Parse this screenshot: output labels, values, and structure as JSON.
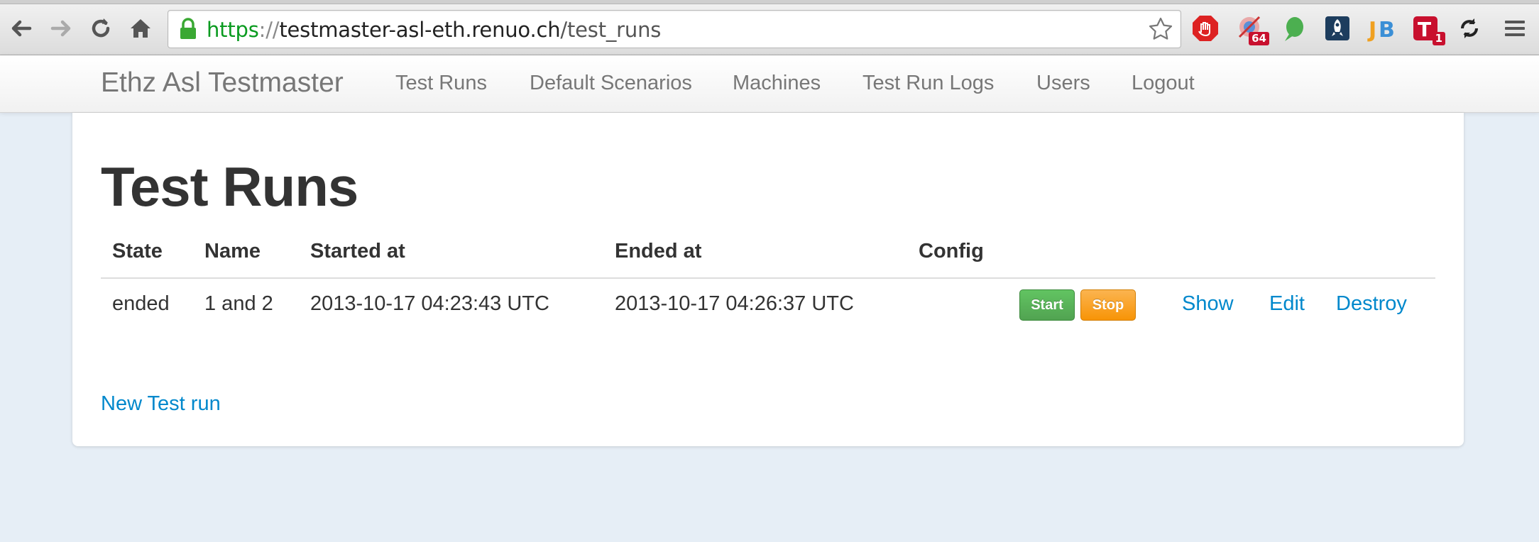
{
  "browser": {
    "url_scheme": "https",
    "url_separator": "://",
    "url_host": "testmaster-asl-eth.renuo.ch",
    "url_path": "/test_runs",
    "icons": [
      "back-icon",
      "forward-icon",
      "reload-icon",
      "home-icon",
      "lock-icon",
      "star-icon",
      "menu-icon"
    ],
    "extensions": [
      {
        "icon": "adblock-icon",
        "badge": ""
      },
      {
        "icon": "feed-icon",
        "badge": "64"
      },
      {
        "icon": "evernote-icon",
        "badge": ""
      },
      {
        "icon": "rocket-icon",
        "badge": ""
      },
      {
        "icon": "jb-icon",
        "badge": ""
      },
      {
        "icon": "t-icon",
        "badge": "1"
      },
      {
        "icon": "sync-icon",
        "badge": ""
      }
    ]
  },
  "navbar": {
    "brand": "Ethz Asl Testmaster",
    "items": [
      "Test Runs",
      "Default Scenarios",
      "Machines",
      "Test Run Logs",
      "Users",
      "Logout"
    ]
  },
  "page": {
    "title": "Test Runs",
    "columns": [
      "State",
      "Name",
      "Started at",
      "Ended at",
      "Config"
    ],
    "rows": [
      {
        "state": "ended",
        "name": "1 and 2",
        "started_at": "2013-10-17 04:23:43 UTC",
        "ended_at": "2013-10-17 04:26:37 UTC",
        "config": "",
        "start_label": "Start",
        "stop_label": "Stop",
        "show_label": "Show",
        "edit_label": "Edit",
        "destroy_label": "Destroy"
      }
    ],
    "new_link": "New Test run"
  },
  "colors": {
    "background": "#e6eef6",
    "link": "#0088cc",
    "start_button": "#5bb75b",
    "stop_button": "#faa732",
    "url_scheme": "#0a9b20"
  }
}
